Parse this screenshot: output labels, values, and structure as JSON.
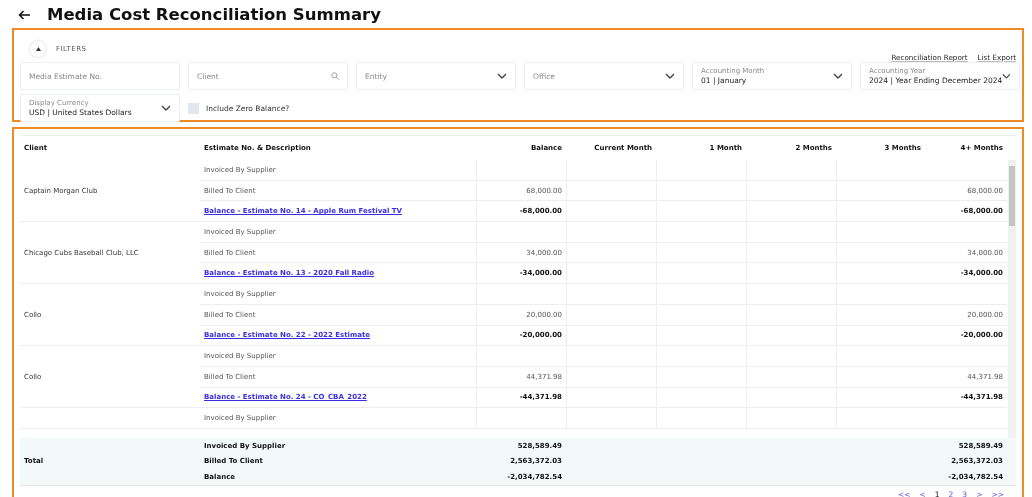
{
  "page": {
    "title": "Media Cost Reconciliation Summary"
  },
  "filters": {
    "toggle_label": "FILTERS",
    "expanded": true,
    "links": [
      "Reconciliation Report",
      "List Export"
    ],
    "fields": [
      {
        "kind": "text",
        "placeholder": "Media Estimate No."
      },
      {
        "kind": "search",
        "placeholder": "Client"
      },
      {
        "kind": "select",
        "placeholder": "Entity"
      },
      {
        "kind": "select",
        "placeholder": "Office"
      },
      {
        "kind": "select",
        "label": "Accounting Month",
        "value": "01 | January"
      },
      {
        "kind": "select",
        "label": "Accounting Year",
        "value": "2024 | Year Ending December 2024"
      },
      {
        "kind": "select",
        "label": "Display Currency",
        "value": "USD | United States Dollars"
      }
    ],
    "zero_balance": {
      "label": "Include Zero Balance?",
      "checked": false
    }
  },
  "table": {
    "columns": [
      "Client",
      "Estimate No. & Description",
      "Balance",
      "Current Month",
      "1 Month",
      "2 Months",
      "3 Months",
      "4+ Months"
    ],
    "groups": [
      {
        "client": "Captain Morgan Club",
        "rows": [
          {
            "kind": "plain",
            "label": "Invoiced By Supplier"
          },
          {
            "kind": "plain",
            "label": "Billed To Client",
            "balance": "68,000.00",
            "months_4_plus": "68,000.00"
          },
          {
            "kind": "balance",
            "label": "Balance - Estimate No. 14 - Apple Rum Festival TV",
            "balance": "-68,000.00",
            "months_4_plus": "-68,000.00"
          }
        ]
      },
      {
        "client": "Chicago Cubs Baseball Club, LLC",
        "rows": [
          {
            "kind": "plain",
            "label": "Invoiced By Supplier"
          },
          {
            "kind": "plain",
            "label": "Billed To Client",
            "balance": "34,000.00",
            "months_4_plus": "34,000.00"
          },
          {
            "kind": "balance",
            "label": "Balance - Estimate No. 13 - 2020 Fall Radio",
            "balance": "-34,000.00",
            "months_4_plus": "-34,000.00"
          }
        ]
      },
      {
        "client": "Collo",
        "rows": [
          {
            "kind": "plain",
            "label": "Invoiced By Supplier"
          },
          {
            "kind": "plain",
            "label": "Billed To Client",
            "balance": "20,000.00",
            "months_4_plus": "20,000.00"
          },
          {
            "kind": "balance",
            "label": "Balance - Estimate No. 22 - 2022 Estimate",
            "balance": "-20,000.00",
            "months_4_plus": "-20,000.00"
          }
        ]
      },
      {
        "client": "Collo",
        "rows": [
          {
            "kind": "plain",
            "label": "Invoiced By Supplier"
          },
          {
            "kind": "plain",
            "label": "Billed To Client",
            "balance": "44,371.98",
            "months_4_plus": "44,371.98"
          },
          {
            "kind": "balance",
            "label": "Balance - Estimate No. 24 - CO_CBA_2022",
            "balance": "-44,371.98",
            "months_4_plus": "-44,371.98"
          }
        ]
      },
      {
        "rows": [
          {
            "kind": "plain",
            "label": "Invoiced By Supplier"
          }
        ]
      }
    ],
    "total": {
      "label": "Total",
      "rows": [
        {
          "label": "Invoiced By Supplier",
          "balance": "528,589.49",
          "months_4_plus": "528,589.49"
        },
        {
          "label": "Billed To Client",
          "balance": "2,563,372.03",
          "months_4_plus": "2,563,372.03"
        },
        {
          "label": "Balance",
          "balance": "-2,034,782.54",
          "months_4_plus": "-2,034,782.54"
        }
      ]
    }
  },
  "pagination": [
    {
      "label": "<<",
      "selected": false
    },
    {
      "label": "<",
      "selected": false
    },
    {
      "label": "1",
      "selected": true
    },
    {
      "label": "2",
      "selected": false
    },
    {
      "label": "3",
      "selected": false
    },
    {
      "label": ">",
      "selected": false
    },
    {
      "label": ">>",
      "selected": false
    }
  ]
}
